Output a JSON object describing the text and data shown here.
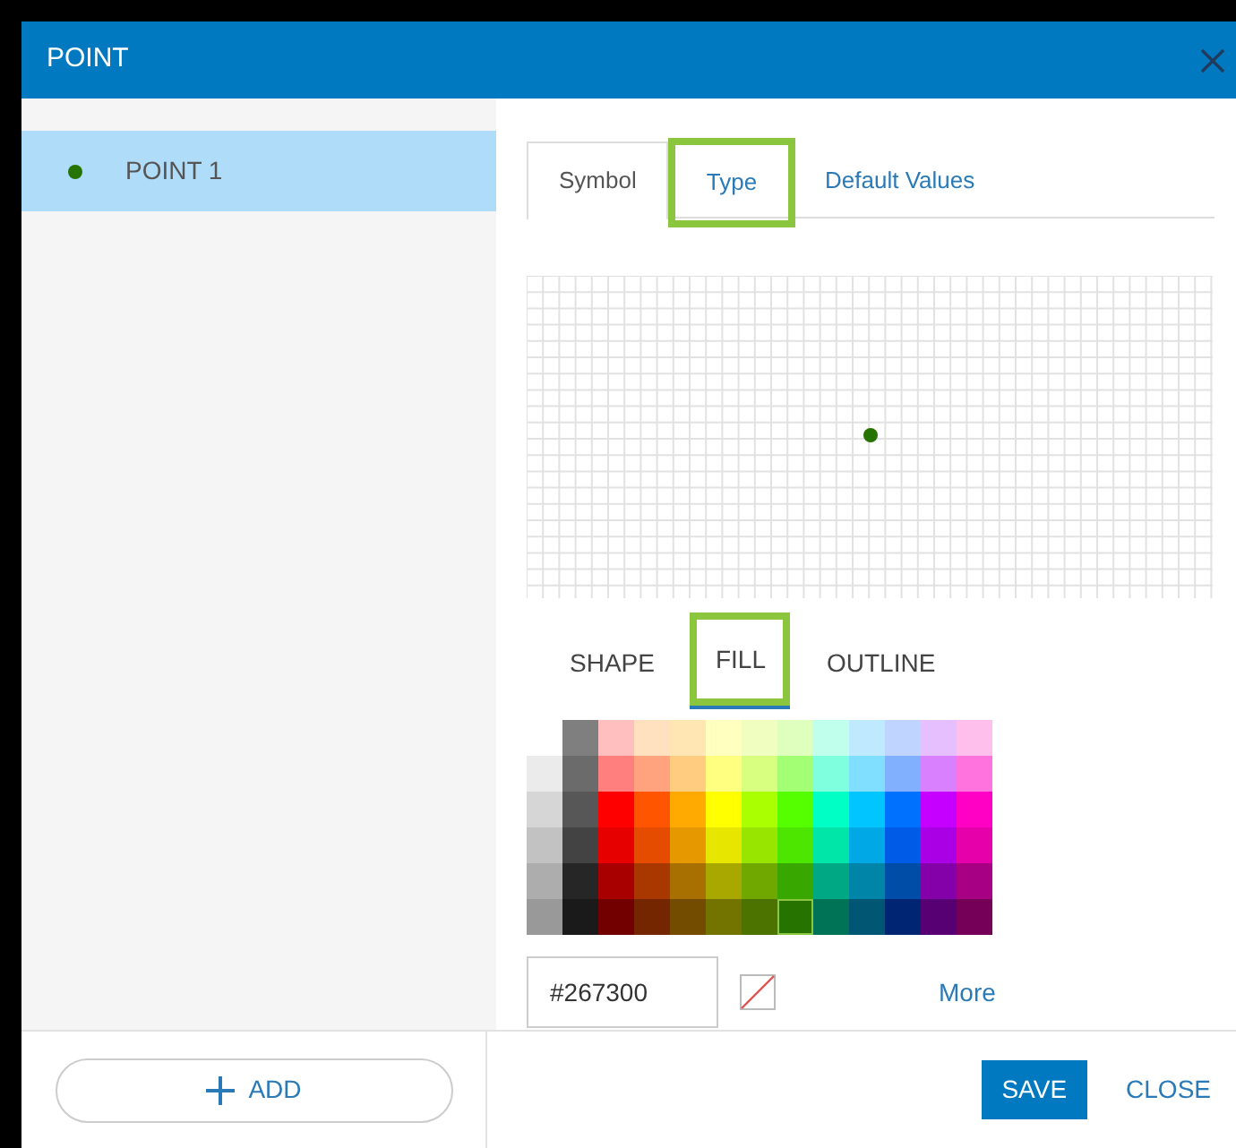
{
  "dialog": {
    "title": "POINT"
  },
  "features": [
    {
      "label": "POINT 1",
      "selected": true,
      "color": "#267300"
    }
  ],
  "tabs": [
    {
      "label": "Symbol",
      "selected": true,
      "highlighted": false
    },
    {
      "label": "Type",
      "selected": false,
      "highlighted": true
    },
    {
      "label": "Default Values",
      "selected": false,
      "highlighted": false
    }
  ],
  "symbol_tabs": [
    {
      "label": "SHAPE",
      "selected": false,
      "highlighted": false
    },
    {
      "label": "FILL",
      "selected": true,
      "highlighted": true
    },
    {
      "label": "OUTLINE",
      "selected": false,
      "highlighted": false
    }
  ],
  "palette": {
    "columns": [
      [
        {
          "color": "#ebebeb",
          "selected": false
        },
        {
          "color": "#d6d6d6",
          "selected": false
        },
        {
          "color": "#c2c2c2",
          "selected": false
        },
        {
          "color": "#adadad",
          "selected": false
        },
        {
          "color": "#999999",
          "selected": false
        }
      ],
      [
        {
          "color": "#7f7f7f",
          "selected": false
        },
        {
          "color": "#6b6b6b",
          "selected": false
        },
        {
          "color": "#575757",
          "selected": false
        },
        {
          "color": "#434343",
          "selected": false
        },
        {
          "color": "#262626",
          "selected": false
        },
        {
          "color": "#1a1a1a",
          "selected": false
        }
      ],
      [
        {
          "color": "#ffbfbf",
          "selected": false
        },
        {
          "color": "#ff7f7f",
          "selected": false
        },
        {
          "color": "#ff0000",
          "selected": false
        },
        {
          "color": "#e60000",
          "selected": false
        },
        {
          "color": "#a80000",
          "selected": false
        },
        {
          "color": "#730000",
          "selected": false
        }
      ],
      [
        {
          "color": "#ffe0bf",
          "selected": false
        },
        {
          "color": "#ffa37f",
          "selected": false
        },
        {
          "color": "#ff5500",
          "selected": false
        },
        {
          "color": "#e64c00",
          "selected": false
        },
        {
          "color": "#a83800",
          "selected": false
        },
        {
          "color": "#732600",
          "selected": false
        }
      ],
      [
        {
          "color": "#ffe6b3",
          "selected": false
        },
        {
          "color": "#ffcc80",
          "selected": false
        },
        {
          "color": "#ffaa00",
          "selected": false
        },
        {
          "color": "#e69800",
          "selected": false
        },
        {
          "color": "#a87000",
          "selected": false
        },
        {
          "color": "#734c00",
          "selected": false
        }
      ],
      [
        {
          "color": "#ffffbf",
          "selected": false
        },
        {
          "color": "#ffff80",
          "selected": false
        },
        {
          "color": "#ffff00",
          "selected": false
        },
        {
          "color": "#e6e600",
          "selected": false
        },
        {
          "color": "#a8a800",
          "selected": false
        },
        {
          "color": "#737300",
          "selected": false
        }
      ],
      [
        {
          "color": "#f0ffbf",
          "selected": false
        },
        {
          "color": "#d9ff80",
          "selected": false
        },
        {
          "color": "#aaff00",
          "selected": false
        },
        {
          "color": "#98e600",
          "selected": false
        },
        {
          "color": "#70a800",
          "selected": false
        },
        {
          "color": "#4c7300",
          "selected": false
        }
      ],
      [
        {
          "color": "#dfffbf",
          "selected": false
        },
        {
          "color": "#a3ff73",
          "selected": false
        },
        {
          "color": "#55ff00",
          "selected": false
        },
        {
          "color": "#4ce600",
          "selected": false
        },
        {
          "color": "#38a800",
          "selected": false
        },
        {
          "color": "#267300",
          "selected": true
        }
      ],
      [
        {
          "color": "#bfffec",
          "selected": false
        },
        {
          "color": "#80ffdf",
          "selected": false
        },
        {
          "color": "#00ffc5",
          "selected": false
        },
        {
          "color": "#00e6a9",
          "selected": false
        },
        {
          "color": "#00a884",
          "selected": false
        },
        {
          "color": "#007356",
          "selected": false
        }
      ],
      [
        {
          "color": "#bfe9ff",
          "selected": false
        },
        {
          "color": "#80dfff",
          "selected": false
        },
        {
          "color": "#00c5ff",
          "selected": false
        },
        {
          "color": "#00a9e6",
          "selected": false
        },
        {
          "color": "#0084a8",
          "selected": false
        },
        {
          "color": "#005673",
          "selected": false
        }
      ],
      [
        {
          "color": "#bfd4ff",
          "selected": false
        },
        {
          "color": "#80b0ff",
          "selected": false
        },
        {
          "color": "#0070ff",
          "selected": false
        },
        {
          "color": "#005ce6",
          "selected": false
        },
        {
          "color": "#004da8",
          "selected": false
        },
        {
          "color": "#002673",
          "selected": false
        }
      ],
      [
        {
          "color": "#e6bfff",
          "selected": false
        },
        {
          "color": "#d980ff",
          "selected": false
        },
        {
          "color": "#c500ff",
          "selected": false
        },
        {
          "color": "#a900e6",
          "selected": false
        },
        {
          "color": "#8400a8",
          "selected": false
        },
        {
          "color": "#560073",
          "selected": false
        }
      ],
      [
        {
          "color": "#ffbfec",
          "selected": false
        },
        {
          "color": "#ff73df",
          "selected": false
        },
        {
          "color": "#ff00c5",
          "selected": false
        },
        {
          "color": "#e600a9",
          "selected": false
        },
        {
          "color": "#a80084",
          "selected": false
        },
        {
          "color": "#730056",
          "selected": false
        }
      ]
    ]
  },
  "hex_field": {
    "value": "#267300"
  },
  "more_link": "More",
  "add_button": "ADD",
  "buttons": [
    {
      "label": "SAVE",
      "kind": "primary"
    },
    {
      "label": "CLOSE",
      "kind": "link"
    }
  ]
}
